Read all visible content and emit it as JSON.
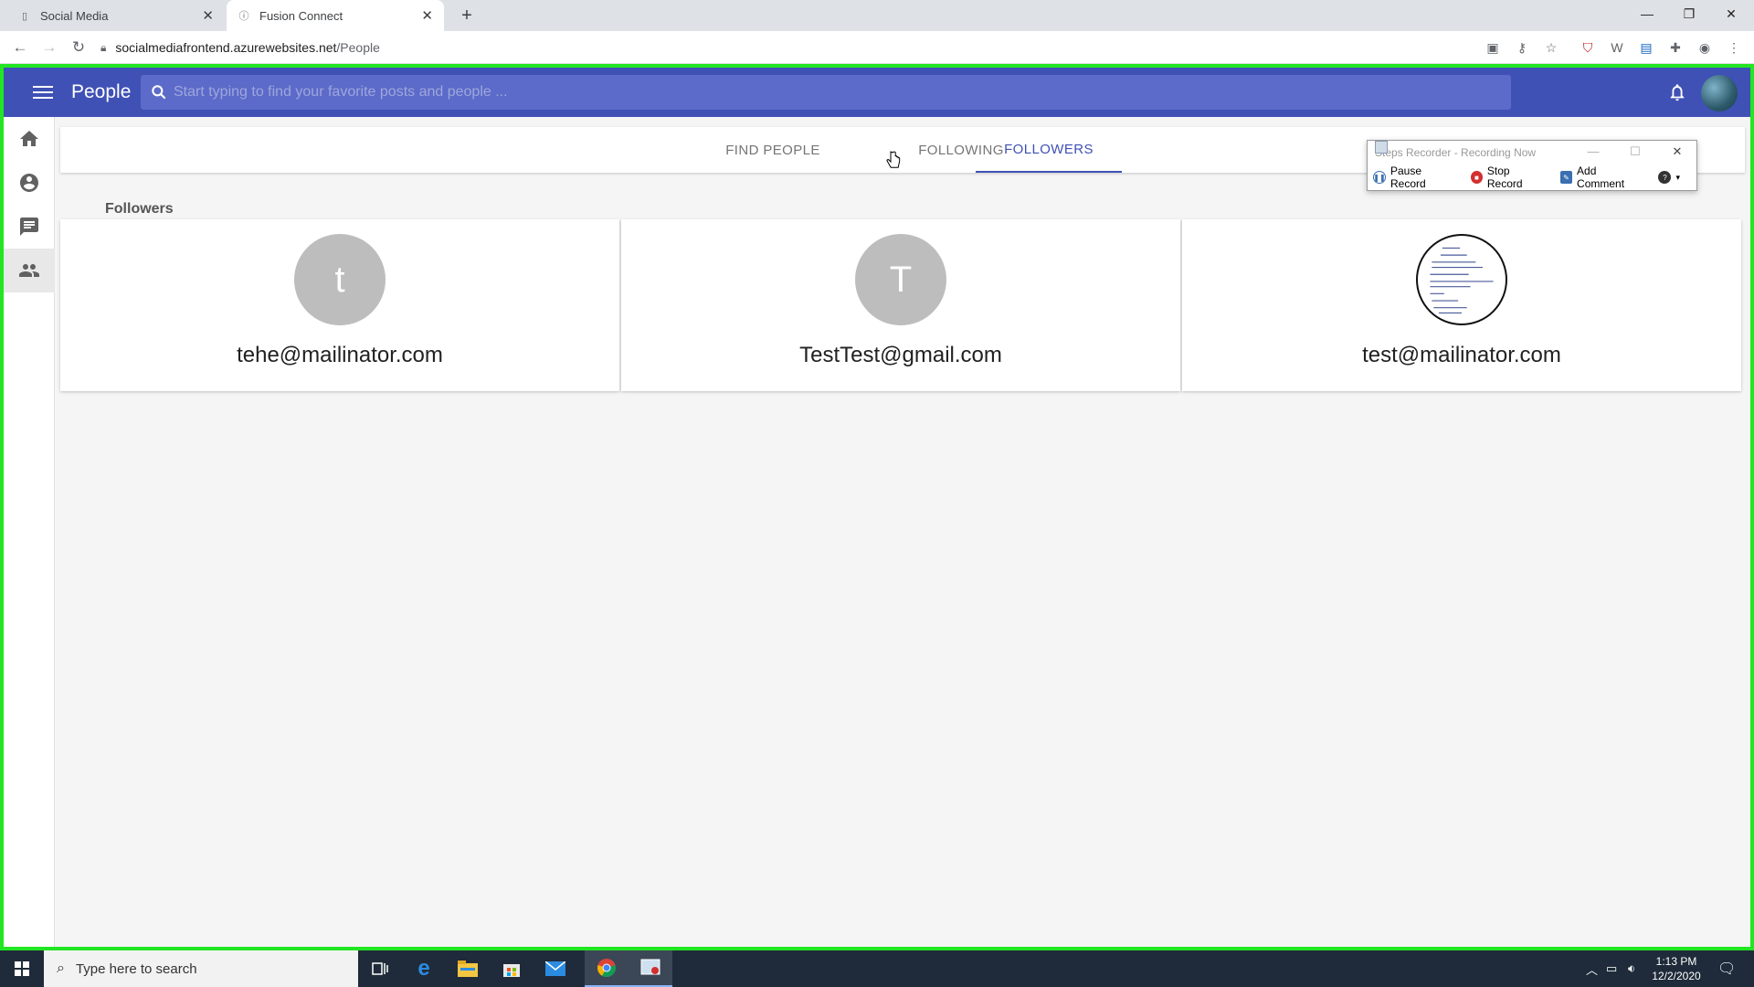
{
  "browser": {
    "tabs": [
      {
        "label": "Social Media",
        "active": false
      },
      {
        "label": "Fusion Connect",
        "active": true
      }
    ],
    "url_host": "socialmediafrontend.azurewebsites.net",
    "url_path": "/People"
  },
  "app": {
    "title": "People",
    "search_placeholder": "Start typing to find your favorite posts and people ..."
  },
  "people_tabs": [
    {
      "label": "FIND PEOPLE",
      "active": false
    },
    {
      "label": "FOLLOWING",
      "active": false
    },
    {
      "label": "FOLLOWERS",
      "active": true
    }
  ],
  "section_label": "Followers",
  "followers": [
    {
      "email": "tehe@mailinator.com",
      "initial": "t",
      "avatar": "letter"
    },
    {
      "email": "TestTest@gmail.com",
      "initial": "T",
      "avatar": "letter"
    },
    {
      "email": "test@mailinator.com",
      "initial": "",
      "avatar": "image"
    }
  ],
  "recorder": {
    "title": "Steps Recorder - Recording Now",
    "pause_label": "Pause Record",
    "stop_label": "Stop Record",
    "comment_label": "Add Comment"
  },
  "taskbar": {
    "search_placeholder": "Type here to search",
    "time": "1:13 PM",
    "date": "12/2/2020"
  },
  "colors": {
    "primary": "#3f51b5",
    "frame": "#22e622",
    "avatar_bg": "#bdbdbd"
  }
}
